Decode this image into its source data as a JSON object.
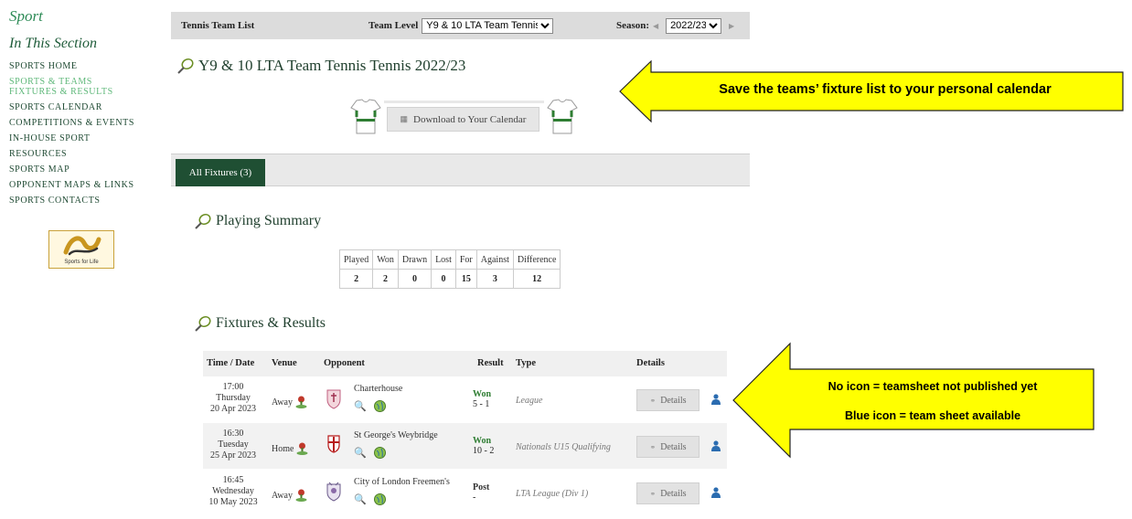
{
  "sidebar": {
    "title": "Sport",
    "subtitle": "In This Section",
    "items": [
      {
        "label": "SPORTS HOME"
      },
      {
        "label": "SPORTS & TEAMS"
      },
      {
        "label": "FIXTURES & RESULTS"
      },
      {
        "label": "SPORTS CALENDAR"
      },
      {
        "label": "COMPETITIONS & EVENTS"
      },
      {
        "label": "IN-HOUSE SPORT"
      },
      {
        "label": "RESOURCES"
      },
      {
        "label": "SPORTS MAP"
      },
      {
        "label": "OPPONENT MAPS & LINKS"
      },
      {
        "label": "SPORTS CONTACTS"
      }
    ],
    "logo_text": "Sports for Life"
  },
  "topbar": {
    "list_title": "Tennis Team List",
    "team_level_label": "Team Level",
    "team_level_value": "Y9 & 10 LTA Team Tennis",
    "season_label": "Season:",
    "season_value": "2022/23"
  },
  "page_title": "Y9 & 10 LTA Team Tennis Tennis 2022/23",
  "download_label": "Download to Your Calendar",
  "tab_all": "All Fixtures (3)",
  "summary": {
    "heading": "Playing Summary",
    "headers": [
      "Played",
      "Won",
      "Drawn",
      "Lost",
      "For",
      "Against",
      "Difference"
    ],
    "values": [
      "2",
      "2",
      "0",
      "0",
      "15",
      "3",
      "12"
    ]
  },
  "fixtures": {
    "heading": "Fixtures & Results",
    "headers": {
      "time_date": "Time / Date",
      "venue": "Venue",
      "opponent": "Opponent",
      "result": "Result",
      "type": "Type",
      "details": "Details"
    },
    "rows": [
      {
        "time": "17:00",
        "day": "Thursday",
        "date": "20 Apr 2023",
        "venue": "Away",
        "opponent": "Charterhouse",
        "result": "Won",
        "score": "5 - 1",
        "type": "League",
        "details": "Details"
      },
      {
        "time": "16:30",
        "day": "Tuesday",
        "date": "25 Apr 2023",
        "venue": "Home",
        "opponent": "St George's Weybridge",
        "result": "Won",
        "score": "10 - 2",
        "type": "Nationals U15 Qualifying",
        "details": "Details"
      },
      {
        "time": "16:45",
        "day": "Wednesday",
        "date": "10 May 2023",
        "venue": "Away",
        "opponent": "City of London Freemen's",
        "result": "Post",
        "score": "-",
        "type": "LTA League (Div 1)",
        "details": "Details"
      }
    ]
  },
  "callouts": {
    "calendar_note": "Save the teams’ fixture list to your personal calendar",
    "teamsheet_line1": "No icon = teamsheet not published yet",
    "teamsheet_line2": "Blue icon = team sheet available"
  },
  "colors": {
    "accent_green": "#1f4f33",
    "callout_fill": "#ffff00",
    "won_green": "#2e7d32"
  }
}
